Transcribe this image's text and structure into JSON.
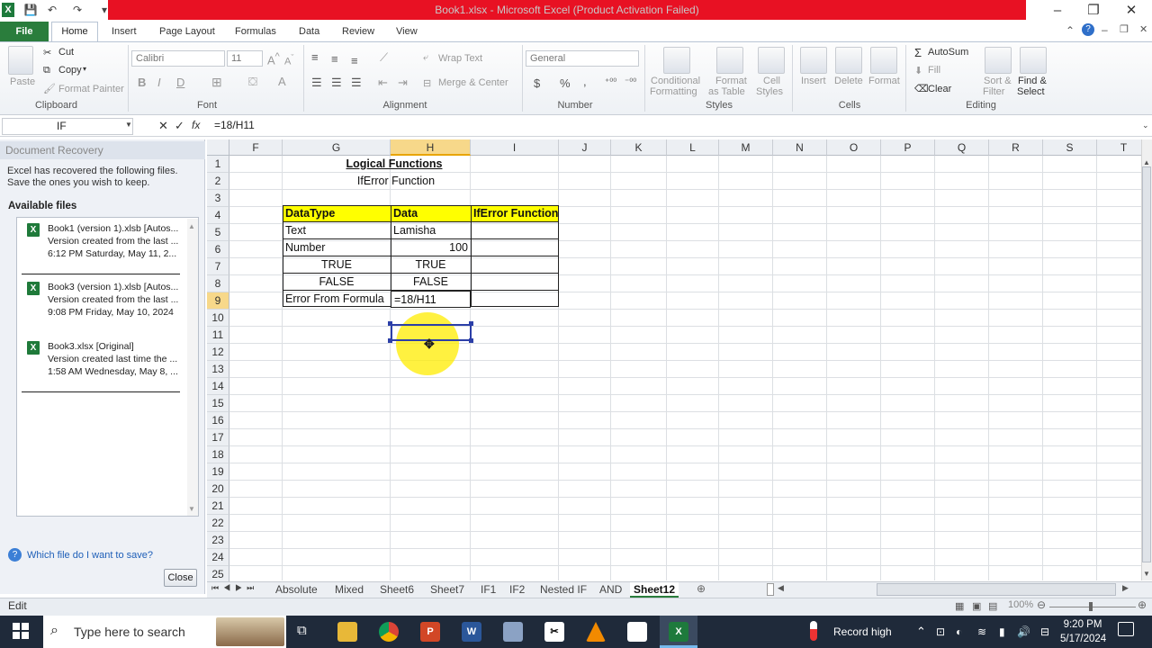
{
  "titlebar": {
    "title": "Book1.xlsx  -  Microsoft Excel (Product Activation Failed)",
    "app_icon_letter": "X",
    "accent_color": "#e81123"
  },
  "tabs": [
    "Home",
    "Insert",
    "Page Layout",
    "Formulas",
    "Data",
    "Review",
    "View"
  ],
  "file_tab": "File",
  "ribbon": {
    "clipboard": {
      "paste": "Paste",
      "cut": "Cut",
      "copy": "Copy",
      "format_painter": "Format Painter",
      "label": "Clipboard"
    },
    "font": {
      "name": "Calibri",
      "size": "11",
      "label": "Font"
    },
    "alignment": {
      "wrap": "Wrap Text",
      "merge": "Merge & Center",
      "label": "Alignment"
    },
    "number": {
      "format": "General",
      "dollar": "$",
      "percent": "%",
      "comma": ",",
      "label": "Number"
    },
    "styles": {
      "conditional": "Conditional",
      "conditional2": "Formatting",
      "format_table": "Format",
      "format_table2": "as Table",
      "cell_styles": "Cell",
      "cell_styles2": "Styles",
      "label": "Styles"
    },
    "cells": {
      "insert": "Insert",
      "delete": "Delete",
      "format": "Format",
      "label": "Cells"
    },
    "editing": {
      "autosum": "AutoSum",
      "fill": "Fill",
      "clear": "Clear",
      "sort": "Sort &",
      "sort2": "Filter",
      "find": "Find &",
      "find2": "Select",
      "label": "Editing"
    }
  },
  "formula_bar": {
    "name_box": "IF",
    "fx": "fx",
    "formula": "=18/H11"
  },
  "recovery": {
    "title": "Document Recovery",
    "message": "Excel has recovered the following files.  Save the ones you wish to keep.",
    "available": "Available files",
    "files": [
      {
        "name": "Book1 (version 1).xlsb  [Autos...",
        "desc": "Version created from the last ...",
        "time": "6:12 PM Saturday, May 11, 2..."
      },
      {
        "name": "Book3 (version 1).xlsb  [Autos...",
        "desc": "Version created from the last ...",
        "time": "9:08 PM Friday, May 10, 2024"
      },
      {
        "name": "Book3.xlsx  [Original]",
        "desc": "Version created last time the ...",
        "time": "1:58 AM Wednesday, May 8, ..."
      }
    ],
    "help_link": "Which file do I want to save?",
    "close": "Close"
  },
  "grid": {
    "columns": [
      "F",
      "G",
      "H",
      "I",
      "J",
      "K",
      "L",
      "M",
      "N",
      "O",
      "P",
      "Q",
      "R",
      "S",
      "T"
    ],
    "rows": [
      "1",
      "2",
      "3",
      "4",
      "5",
      "6",
      "7",
      "8",
      "9",
      "10",
      "11",
      "12",
      "13",
      "14",
      "15",
      "16",
      "17",
      "18",
      "19",
      "20",
      "21",
      "22",
      "23",
      "24",
      "25"
    ],
    "title": "Logical Functions",
    "subtitle": "IfError Function",
    "table_header": [
      "DataType",
      "Data",
      "IfError Function"
    ],
    "table_rows": [
      [
        "Text",
        "Lamisha",
        ""
      ],
      [
        "Number",
        "100",
        ""
      ],
      [
        "TRUE",
        "TRUE",
        ""
      ],
      [
        "FALSE",
        "FALSE",
        ""
      ],
      [
        "Error From Formula",
        "=18/H11",
        ""
      ]
    ],
    "header_color": "#ffff00"
  },
  "sheet_tabs": [
    "Absolute",
    "Mixed",
    "Sheet6",
    "Sheet7",
    "IF1",
    "IF2",
    "Nested IF",
    "AND",
    "Sheet12"
  ],
  "active_sheet": "Sheet12",
  "status": {
    "mode": "Edit",
    "zoom": "100%"
  },
  "taskbar": {
    "search_placeholder": "Type here to search",
    "record": "Record high",
    "time": "9:20 PM",
    "date": "5/17/2024"
  }
}
